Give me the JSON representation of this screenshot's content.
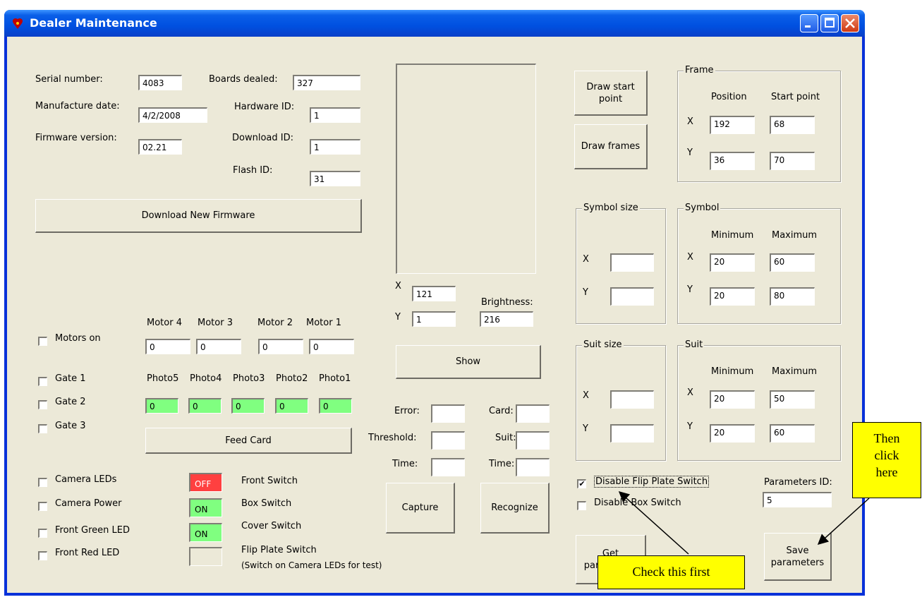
{
  "window": {
    "title": "Dealer Maintenance"
  },
  "info": {
    "serial_label": "Serial number:",
    "serial_value": "4083",
    "manufacture_label": "Manufacture date:",
    "manufacture_value": "4/2/2008",
    "firmware_label": "Firmware version:",
    "firmware_value": "02.21",
    "boards_label": "Boards dealed:",
    "boards_value": "327",
    "hardware_label": "Hardware ID:",
    "hardware_value": "1",
    "download_label": "Download ID:",
    "download_value": "1",
    "flash_label": "Flash ID:",
    "flash_value": "31",
    "download_firmware_button": "Download New Firmware"
  },
  "motors": {
    "motors_on_label": "Motors on",
    "headers": [
      "Motor 4",
      "Motor 3",
      "Motor 2",
      "Motor 1"
    ],
    "values": [
      "0",
      "0",
      "0",
      "0"
    ]
  },
  "gates": [
    "Gate 1",
    "Gate 2",
    "Gate 3"
  ],
  "photos": {
    "headers": [
      "Photo5",
      "Photo4",
      "Photo3",
      "Photo2",
      "Photo1"
    ],
    "values": [
      "0",
      "0",
      "0",
      "0",
      "0"
    ]
  },
  "feed_card_button": "Feed Card",
  "toggles": [
    "Camera LEDs",
    "Camera Power",
    "Front Green LED",
    "Front Red LED"
  ],
  "switches": [
    {
      "state": "OFF",
      "label": "Front Switch",
      "color": "#ff4040"
    },
    {
      "state": "ON",
      "label": "Box Switch",
      "color": "#80ff80"
    },
    {
      "state": "ON",
      "label": "Cover Switch",
      "color": "#80ff80"
    },
    {
      "state": "",
      "label": "Flip Plate Switch",
      "color": "#ece9d8"
    }
  ],
  "flip_note": "(Switch on Camera LEDs for test)",
  "camera": {
    "x_label": "X",
    "x_value": "121",
    "y_label": "Y",
    "y_value": "1",
    "brightness_label": "Brightness:",
    "brightness_value": "216",
    "show_button": "Show",
    "error_label": "Error:",
    "threshold_label": "Threshold:",
    "time_label": "Time:",
    "card_label": "Card:",
    "suit_label": "Suit:",
    "time2_label": "Time:",
    "capture_button": "Capture",
    "recognize_button": "Recognize"
  },
  "draw_start_button": "Draw start point",
  "draw_frames_button": "Draw frames",
  "frame": {
    "title": "Frame",
    "col1": "Position",
    "col2": "Start point",
    "x_label": "X",
    "y_label": "Y",
    "x_pos": "192",
    "x_start": "68",
    "y_pos": "36",
    "y_start": "70"
  },
  "symbol_size": {
    "title": "Symbol size",
    "x_label": "X",
    "y_label": "Y"
  },
  "symbol": {
    "title": "Symbol",
    "col1": "Minimum",
    "col2": "Maximum",
    "x_label": "X",
    "y_label": "Y",
    "x_min": "20",
    "x_max": "60",
    "y_min": "20",
    "y_max": "80"
  },
  "suit_size": {
    "title": "Suit size",
    "x_label": "X",
    "y_label": "Y"
  },
  "suit": {
    "title": "Suit",
    "col1": "Minimum",
    "col2": "Maximum",
    "x_label": "X",
    "y_label": "Y",
    "x_min": "20",
    "x_max": "50",
    "y_min": "20",
    "y_max": "60"
  },
  "options": {
    "disable_flip_label": "Disable Flip Plate Switch",
    "disable_flip_checked": "✔",
    "disable_box_label": "Disable Box Switch",
    "params_id_label": "Parameters ID:",
    "params_id_value": "5"
  },
  "get_params_button": "Get parameters",
  "save_params_button": "Save parameters",
  "annotations": {
    "check_first": "Check this first",
    "then_click": "Then click here"
  }
}
